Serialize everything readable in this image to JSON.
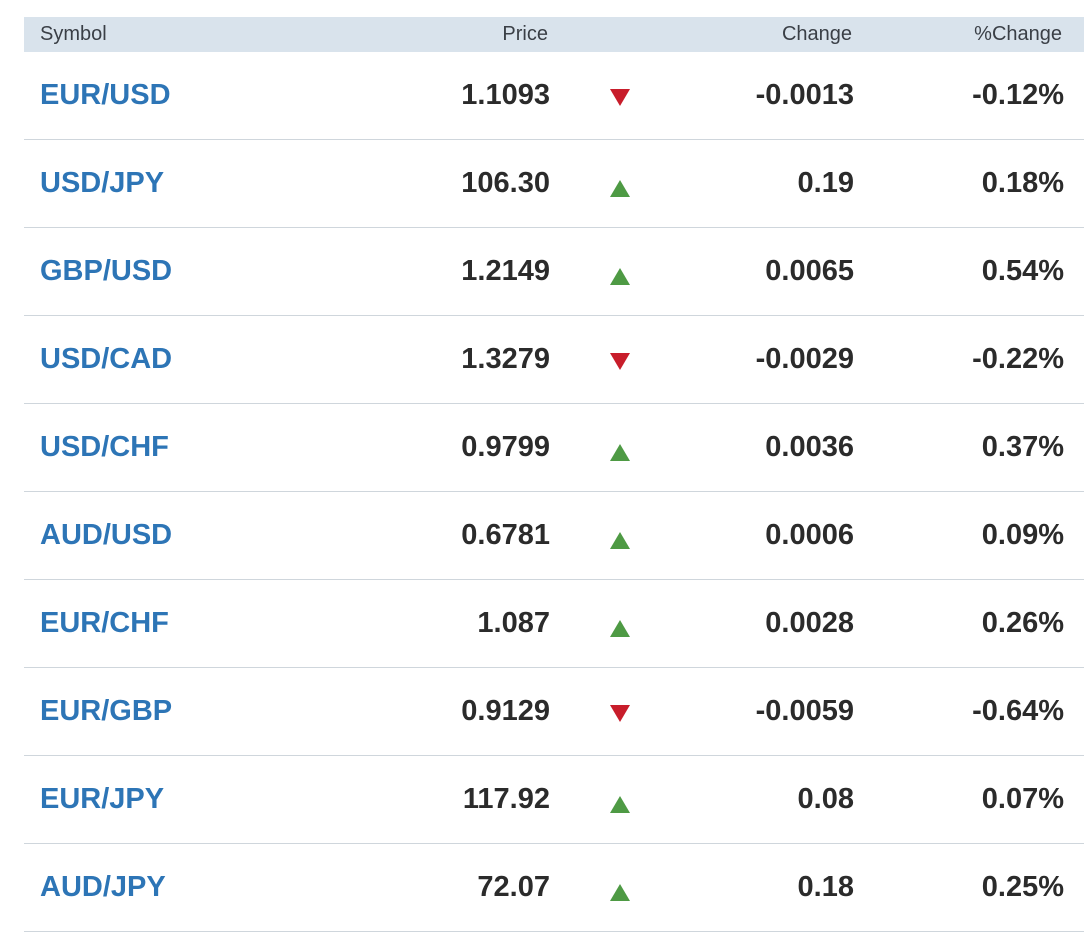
{
  "header": {
    "symbol": "Symbol",
    "price": "Price",
    "change": "Change",
    "pct_change": "%Change"
  },
  "colors": {
    "header_bg": "#d9e3ec",
    "symbol_link": "#2d75b6",
    "up": "#4e9a44",
    "down": "#c81d2b"
  },
  "rows": [
    {
      "symbol": "EUR/USD",
      "price": "1.1093",
      "direction": "down",
      "change": "-0.0013",
      "pct_change": "-0.12%"
    },
    {
      "symbol": "USD/JPY",
      "price": "106.30",
      "direction": "up",
      "change": "0.19",
      "pct_change": "0.18%"
    },
    {
      "symbol": "GBP/USD",
      "price": "1.2149",
      "direction": "up",
      "change": "0.0065",
      "pct_change": "0.54%"
    },
    {
      "symbol": "USD/CAD",
      "price": "1.3279",
      "direction": "down",
      "change": "-0.0029",
      "pct_change": "-0.22%"
    },
    {
      "symbol": "USD/CHF",
      "price": "0.9799",
      "direction": "up",
      "change": "0.0036",
      "pct_change": "0.37%"
    },
    {
      "symbol": "AUD/USD",
      "price": "0.6781",
      "direction": "up",
      "change": "0.0006",
      "pct_change": "0.09%"
    },
    {
      "symbol": "EUR/CHF",
      "price": "1.087",
      "direction": "up",
      "change": "0.0028",
      "pct_change": "0.26%"
    },
    {
      "symbol": "EUR/GBP",
      "price": "0.9129",
      "direction": "down",
      "change": "-0.0059",
      "pct_change": "-0.64%"
    },
    {
      "symbol": "EUR/JPY",
      "price": "117.92",
      "direction": "up",
      "change": "0.08",
      "pct_change": "0.07%"
    },
    {
      "symbol": "AUD/JPY",
      "price": "72.07",
      "direction": "up",
      "change": "0.18",
      "pct_change": "0.25%"
    }
  ]
}
